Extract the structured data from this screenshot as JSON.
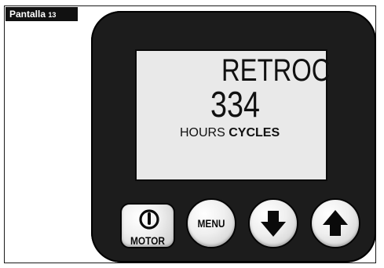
{
  "tag": {
    "label": "Pantalla",
    "number": "13"
  },
  "lcd": {
    "line1": "RETROC",
    "line2": "334",
    "hours_label": "HOURS",
    "cycles_label": "CYCLES"
  },
  "buttons": {
    "motor_label": "MOTOR",
    "menu_label": "MENU",
    "motor_icon": "power-icon",
    "down_icon": "arrow-down-icon",
    "up_icon": "arrow-up-icon"
  },
  "colors": {
    "device_body": "#1c1c1c",
    "lcd_background": "#e9e9e9",
    "tag_background": "#111111"
  }
}
